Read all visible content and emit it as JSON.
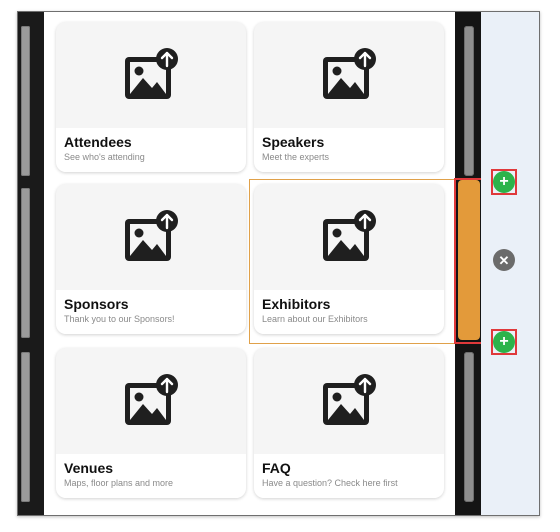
{
  "tiles": [
    {
      "title": "Attendees",
      "subtitle": "See who's attending"
    },
    {
      "title": "Speakers",
      "subtitle": "Meet the experts"
    },
    {
      "title": "Sponsors",
      "subtitle": "Thank you to our Sponsors!"
    },
    {
      "title": "Exhibitors",
      "subtitle": "Learn about our Exhibitors"
    },
    {
      "title": "Venues",
      "subtitle": "Maps, floor plans and more"
    },
    {
      "title": "FAQ",
      "subtitle": "Have a question? Check here first"
    }
  ],
  "controls": {
    "add_icon": "plus-circle-icon",
    "remove_icon": "x-circle-icon",
    "image_icon": "image-upload-icon"
  },
  "colors": {
    "add": "#2cb34a",
    "remove": "#6b6b6b",
    "handle": "#e39a3a",
    "highlight": "#e0393b",
    "selection": "#e0a14a"
  }
}
